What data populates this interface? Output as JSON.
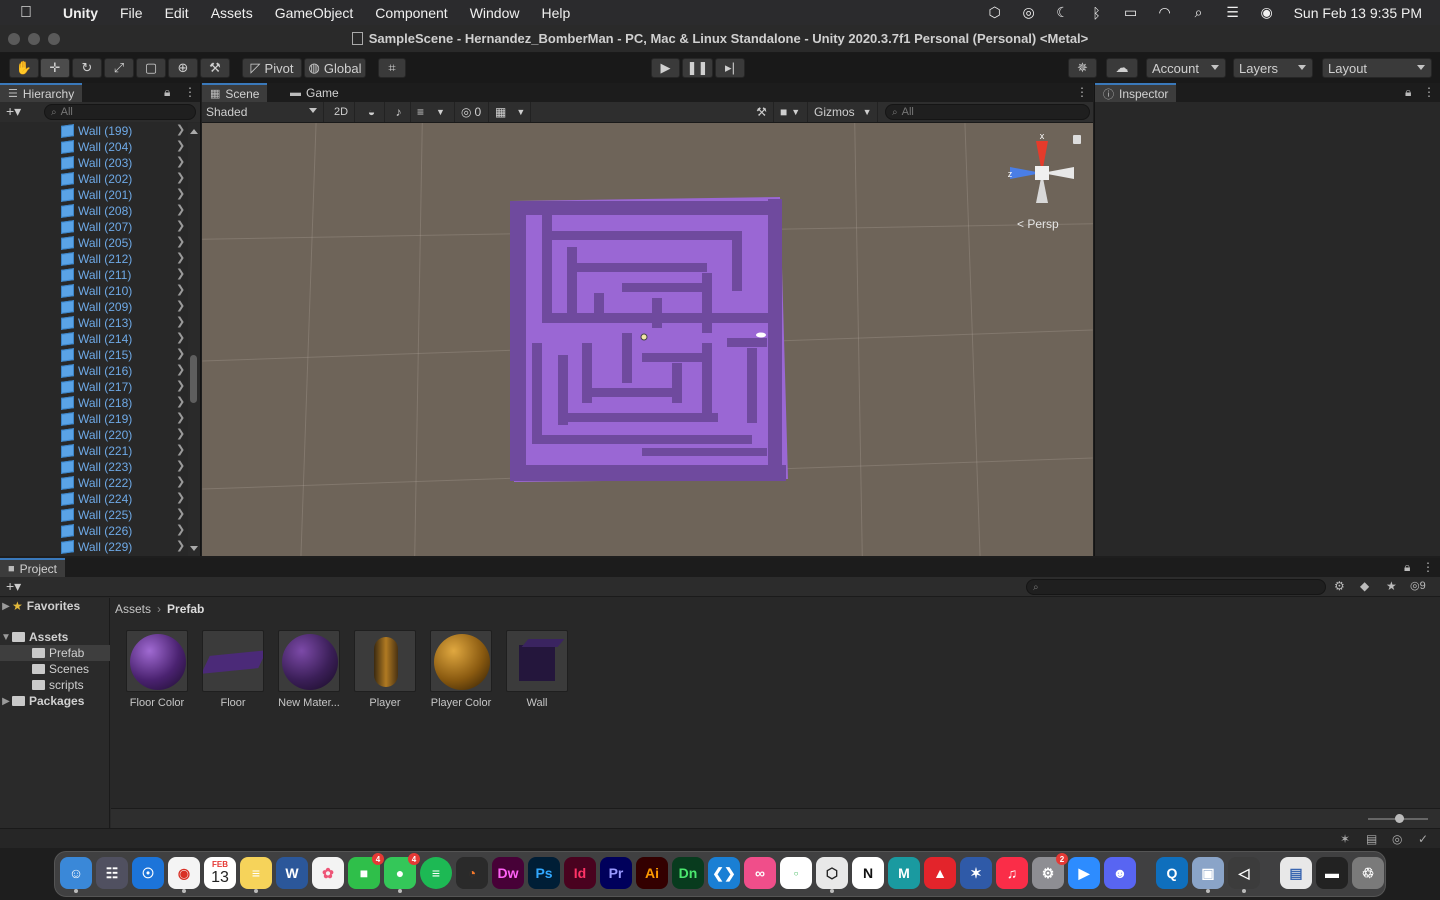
{
  "menubar": {
    "app": "Unity",
    "items": [
      "File",
      "Edit",
      "Assets",
      "GameObject",
      "Component",
      "Window",
      "Help"
    ],
    "clock": "Sun Feb 13  9:35 PM"
  },
  "window": {
    "title": "SampleScene - Hernandez_BomberMan - PC, Mac & Linux Standalone - Unity 2020.3.7f1 Personal (Personal) <Metal>"
  },
  "toolbar": {
    "pivot": "Pivot",
    "global": "Global",
    "account": "Account",
    "layers": "Layers",
    "layout": "Layout"
  },
  "hierarchy": {
    "tab": "Hierarchy",
    "search_placeholder": "All",
    "items": [
      "Wall (199)",
      "Wall (204)",
      "Wall (203)",
      "Wall (202)",
      "Wall (201)",
      "Wall (208)",
      "Wall (207)",
      "Wall (205)",
      "Wall (212)",
      "Wall (211)",
      "Wall (210)",
      "Wall (209)",
      "Wall (213)",
      "Wall (214)",
      "Wall (215)",
      "Wall (216)",
      "Wall (217)",
      "Wall (218)",
      "Wall (219)",
      "Wall (220)",
      "Wall (221)",
      "Wall (223)",
      "Wall (222)",
      "Wall (224)",
      "Wall (225)",
      "Wall (226)",
      "Wall (229)"
    ]
  },
  "scene": {
    "tabs": [
      "Scene",
      "Game"
    ],
    "shading": "Shaded",
    "mode_2d": "2D",
    "hidden_count": "0",
    "gizmos": "Gizmos",
    "search_placeholder": "All",
    "gizmo_x": "x",
    "gizmo_z": "z",
    "persp": "< Persp"
  },
  "inspector": {
    "tab": "Inspector"
  },
  "project": {
    "tab": "Project",
    "hidden_count": "9",
    "tree": {
      "favorites": "Favorites",
      "assets": "Assets",
      "folders": [
        "Prefab",
        "Scenes",
        "scripts"
      ],
      "packages": "Packages"
    },
    "breadcrumb": {
      "root": "Assets",
      "current": "Prefab"
    },
    "assets": [
      "Floor Color",
      "Floor",
      "New Mater...",
      "Player",
      "Player Color",
      "Wall"
    ]
  },
  "dock": {
    "calendar_month": "FEB",
    "calendar_day": "13",
    "apps": [
      "Dw",
      "Ps",
      "Id",
      "Pr",
      "Ai",
      "Dn",
      "M"
    ],
    "badges": [
      "4",
      "4",
      "2"
    ]
  }
}
